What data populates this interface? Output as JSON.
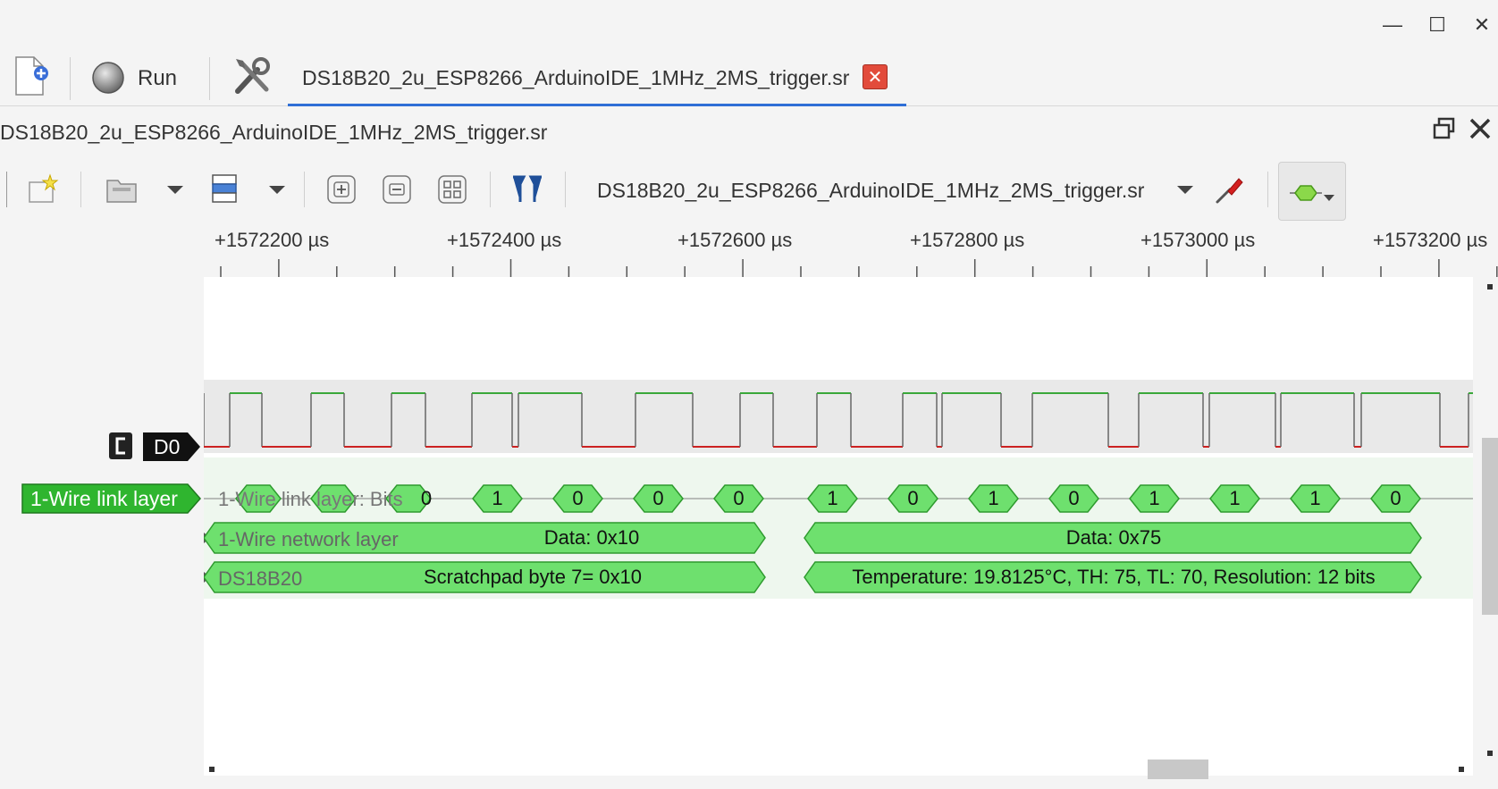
{
  "window": {
    "minimize_glyph": "—",
    "maximize_glyph": "☐",
    "close_glyph": "✕"
  },
  "toolbar": {
    "new_session_icon": "new-document-icon",
    "run_label": "Run",
    "settings_icon": "tools-icon"
  },
  "session_tab": {
    "label": "DS18B20_2u_ESP8266_ArduinoIDE_1MHz_2MS_trigger.sr",
    "close_glyph": "✕"
  },
  "view": {
    "title": "DS18B20_2u_ESP8266_ArduinoIDE_1MHz_2MS_trigger.sr",
    "session_combo": "DS18B20_2u_ESP8266_ArduinoIDE_1MHz_2MS_trigger.sr"
  },
  "ruler": {
    "labels": [
      "+1572200 µs",
      "+1572400 µs",
      "+1572600 µs",
      "+1572800 µs",
      "+1573000 µs",
      "+1573200 µs"
    ]
  },
  "signals": {
    "d0_label": "D0",
    "decoder_label": "1-Wire link layer",
    "row_bits": "1-Wire link layer: Bits",
    "row_network": "1-Wire network layer",
    "row_device": "DS18B20"
  },
  "annotations": {
    "bits_first": [
      "0"
    ],
    "bits": [
      "1",
      "0",
      "0",
      "0",
      "1",
      "0",
      "1",
      "0",
      "1",
      "1",
      "1",
      "0"
    ],
    "network": [
      "Data: 0x10",
      "Data: 0x75"
    ],
    "device": [
      "Scratchpad byte 7= 0x10",
      "Temperature: 19.8125°C, TH: 75, TL: 70, Resolution: 12 bits"
    ]
  },
  "colors": {
    "trace_high": "#3aa83a",
    "trace_low": "#cc2222",
    "annotation_fill": "#6ee06e",
    "annotation_stroke": "#2e9a2e",
    "decoder_bg": "#eef7ee",
    "accent": "#2f6fd6"
  }
}
